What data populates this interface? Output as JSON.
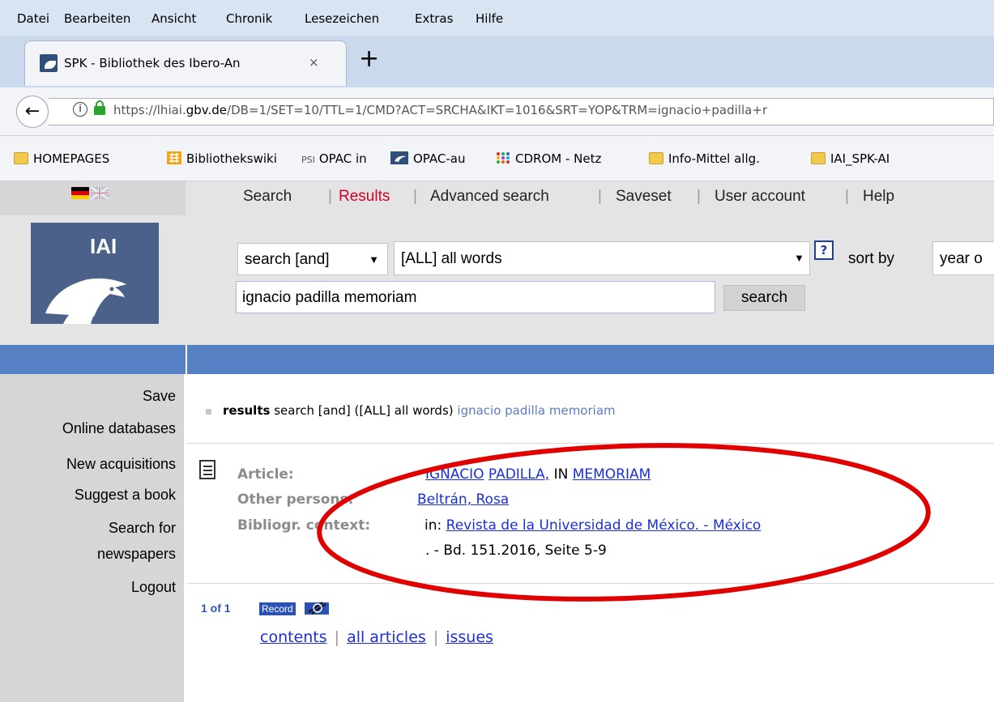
{
  "menubar": {
    "items": [
      {
        "label": "Datei"
      },
      {
        "label": "Bearbeiten"
      },
      {
        "label": "Ansicht"
      },
      {
        "label": "Chronik"
      },
      {
        "label": "Lesezeichen"
      },
      {
        "label": "Extras"
      },
      {
        "label": "Hilfe"
      }
    ]
  },
  "tab": {
    "title": "SPK - Bibliothek des Ibero-An",
    "close": "×",
    "new_tab": "+"
  },
  "navbar": {
    "back": "←",
    "info": "i",
    "url_prefix": "https://lhiai.",
    "url_domain": "gbv.de",
    "url_rest": "/DB=1/SET=10/TTL=1/CMD?ACT=SRCHA&IKT=1016&SRT=YOP&TRM=ignacio+padilla+r"
  },
  "bookmarks": [
    {
      "label": "HOMEPAGES",
      "icon": "folder-icon"
    },
    {
      "label": "Bibliothekswiki",
      "icon": "wiki-icon"
    },
    {
      "label": "OPAC in",
      "icon": "psi-icon",
      "prefix": "PSI"
    },
    {
      "label": "OPAC-au",
      "icon": "iai-icon"
    },
    {
      "label": "CDROM - Netz",
      "icon": "dots-icon"
    },
    {
      "label": "Info-Mittel allg.",
      "icon": "folder-icon"
    },
    {
      "label": "IAI_SPK-AI",
      "icon": "folder-icon"
    }
  ],
  "topnav": {
    "items": [
      {
        "label": "Search"
      },
      {
        "label": "Results",
        "active": true
      },
      {
        "label": "Advanced search"
      },
      {
        "label": "Saveset"
      },
      {
        "label": "User account"
      },
      {
        "label": "Help"
      }
    ],
    "separator": "|"
  },
  "logo": {
    "text": "IAI"
  },
  "search": {
    "operator": "search [and]",
    "field": "[ALL] all words",
    "help": "?",
    "sort_label": "sort by",
    "sort_value": "year o",
    "query": "ignacio padilla memoriam",
    "button": "search"
  },
  "sidebar": {
    "items": [
      {
        "label": "Save"
      },
      {
        "label": "Online databases"
      },
      {
        "label": "New acquisitions"
      },
      {
        "label": "Suggest a book"
      },
      {
        "label": "Search for"
      },
      {
        "label": "newspapers"
      },
      {
        "label": "Logout"
      }
    ]
  },
  "results": {
    "heading_bold": "results",
    "heading_text": "search [and] ([ALL] all words)",
    "heading_query": "ignacio padilla memoriam",
    "record": {
      "article_label": "Article:",
      "article_link1": "IGNACIO",
      "article_link2": "PADILLA,",
      "article_in": "IN",
      "article_link3": "MEMORIAM",
      "persons_label": "Other persons:",
      "persons_link": "Beltrán, Rosa",
      "context_label": "Bibliogr. context:",
      "context_prefix": "in:",
      "context_link": "Revista de la Universidad de México. - México",
      "context_detail": ". - Bd. 151.2016, Seite 5-9"
    },
    "pager": {
      "count": "1 of 1",
      "record_badge": "Record",
      "links": [
        "contents",
        "all articles",
        "issues"
      ],
      "separator": "|"
    }
  },
  "colors": {
    "accent_blue": "#5580c3",
    "active_nav": "#d4002a",
    "link": "#1a2fd9",
    "highlight_oval": "#e00000"
  }
}
